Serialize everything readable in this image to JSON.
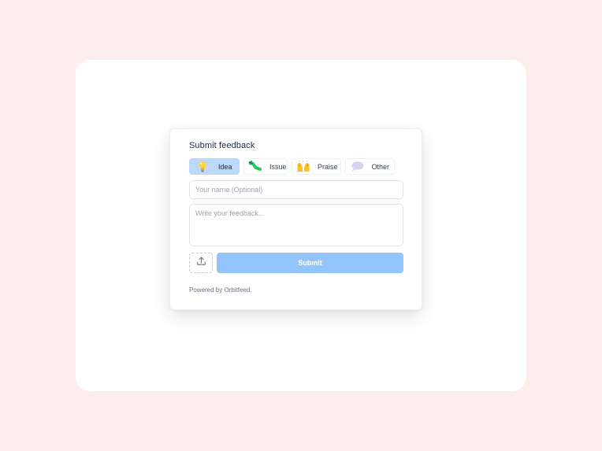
{
  "widget": {
    "title": "Submit feedback",
    "types": [
      {
        "label": "Idea",
        "icon": "lightbulb-icon",
        "active": true
      },
      {
        "label": "Issue",
        "icon": "bug-icon",
        "active": false
      },
      {
        "label": "Praise",
        "icon": "raised-hands-icon",
        "active": false
      },
      {
        "label": "Other",
        "icon": "speech-bubble-icon",
        "active": false
      }
    ],
    "name_placeholder": "Your name (Optional)",
    "name_value": "",
    "feedback_placeholder": "Write your feedback...",
    "feedback_value": "",
    "upload_icon": "upload-icon",
    "submit_label": "Submit",
    "powered_by": "Powered by Orbitfeed."
  },
  "colors": {
    "page_background": "#fdeeed",
    "card_background": "#ffffff",
    "active_type_background": "#bcd8fb",
    "submit_background": "#93c5fd"
  }
}
